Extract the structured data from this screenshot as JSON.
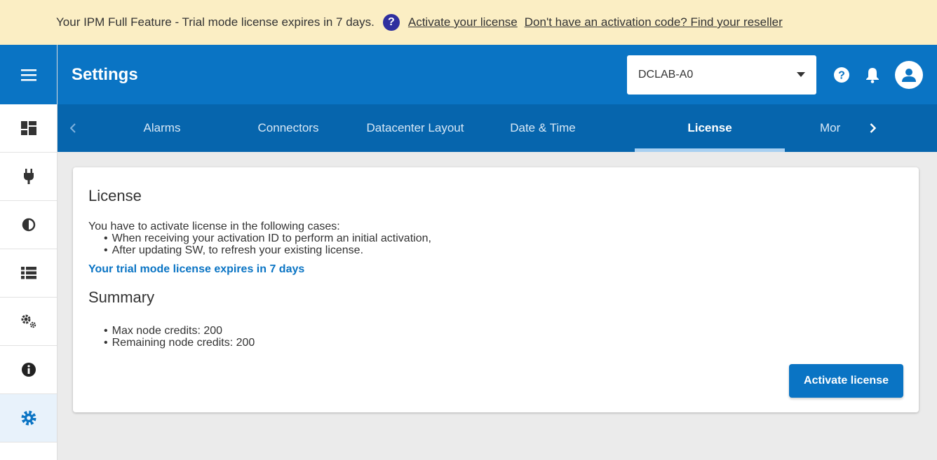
{
  "banner": {
    "message": "Your IPM Full Feature - Trial mode license expires in 7 days.",
    "help_icon": "question-circle-icon",
    "activate_link": "Activate your license",
    "reseller_link": "Don't have an activation code? Find your reseller"
  },
  "header": {
    "title": "Settings",
    "site_select_value": "DCLAB-A0"
  },
  "tabs": [
    {
      "label": "Alarms"
    },
    {
      "label": "Connectors"
    },
    {
      "label": "Datacenter Layout"
    },
    {
      "label": "Date & Time"
    },
    {
      "label": "License"
    },
    {
      "label": "Mor"
    }
  ],
  "active_tab": "License",
  "sidebar": {
    "items": [
      {
        "icon": "dashboard-icon"
      },
      {
        "icon": "plug-icon"
      },
      {
        "icon": "contrast-icon"
      },
      {
        "icon": "list-icon"
      },
      {
        "icon": "cogs-icon"
      },
      {
        "icon": "info-icon"
      },
      {
        "icon": "settings-gear-icon",
        "active": true
      }
    ]
  },
  "license": {
    "heading": "License",
    "intro": "You have to activate license in the following cases:",
    "cases": [
      "When receiving your activation ID to perform an initial activation,",
      "After updating SW, to refresh your existing license."
    ],
    "trial_notice": "Your trial mode license expires in 7 days",
    "summary_heading": "Summary",
    "summary_items": [
      "Max node credits: 200",
      "Remaining node credits: 200"
    ],
    "activate_button": "Activate license"
  },
  "colors": {
    "primary": "#0a74c4",
    "tabs_bg": "#0665ad",
    "banner_bg": "#fbeec4",
    "help_icon": "#2f2f9f"
  }
}
